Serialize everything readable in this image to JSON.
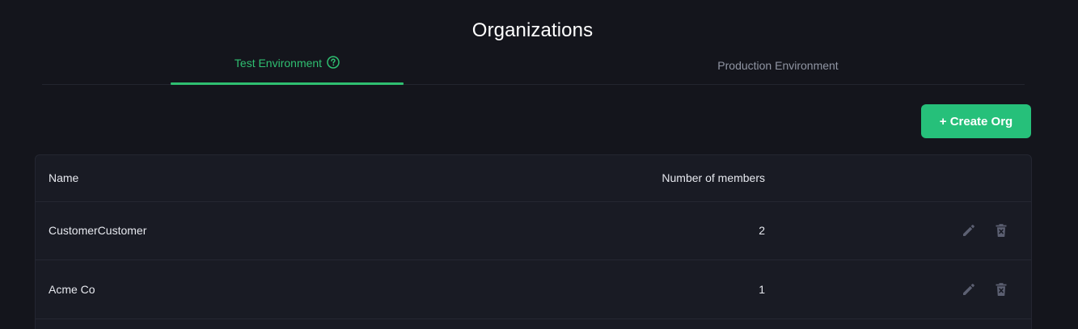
{
  "page": {
    "title": "Organizations"
  },
  "tabs": [
    {
      "label": "Test Environment",
      "active": true
    },
    {
      "label": "Production Environment",
      "active": false
    }
  ],
  "toolbar": {
    "create_label": "+ Create Org"
  },
  "table": {
    "columns": [
      "Name",
      "Number of members"
    ],
    "rows": [
      {
        "name": "CustomerCustomer",
        "members": "2"
      },
      {
        "name": "Acme Co",
        "members": "1"
      }
    ]
  },
  "icons": {
    "help": "help-circle-icon",
    "edit": "pencil-icon",
    "delete": "trash-x-icon"
  },
  "colors": {
    "background": "#14151c",
    "accent": "#2fbf71",
    "button": "#26c07a",
    "card": "#191b24",
    "muted_icon": "#5c6072",
    "inactive_tab": "#9095a3"
  }
}
